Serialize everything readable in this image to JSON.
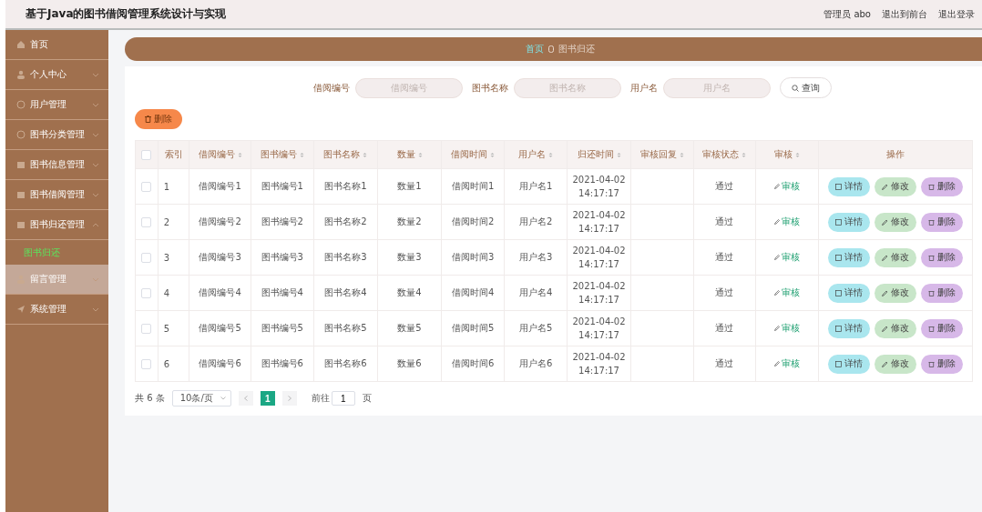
{
  "header": {
    "title": "基于Java的图书借阅管理系统设计与实现",
    "user": "管理员 abo",
    "links": [
      "退出到前台",
      "退出登录"
    ]
  },
  "sidebar": {
    "items": [
      {
        "label": "首页",
        "hovered": false
      },
      {
        "label": "个人中心",
        "expanded": false,
        "hovered": false
      },
      {
        "label": "用户管理",
        "expanded": false,
        "hovered": false
      },
      {
        "label": "图书分类管理",
        "expanded": false,
        "hovered": false
      },
      {
        "label": "图书信息管理",
        "expanded": false,
        "hovered": false
      },
      {
        "label": "图书借阅管理",
        "expanded": false,
        "hovered": false
      },
      {
        "label": "图书归还管理",
        "expanded": true,
        "hovered": false,
        "children": [
          {
            "label": "图书归还",
            "selected": true
          }
        ]
      },
      {
        "label": "留言管理",
        "expanded": false,
        "hovered": true
      },
      {
        "label": "系统管理",
        "expanded": false,
        "hovered": false
      }
    ]
  },
  "breadcrumb": [
    "首页",
    "图书归还"
  ],
  "search": {
    "fields": [
      {
        "label": "借阅编号",
        "placeholder": "借阅编号"
      },
      {
        "label": "图书名称",
        "placeholder": "图书名称"
      },
      {
        "label": "用户名",
        "placeholder": "用户名"
      }
    ],
    "button": "查询"
  },
  "delete_button": "删除",
  "table": {
    "header_checked": false,
    "columns": [
      {
        "label": "索引",
        "sortable": false
      },
      {
        "label": "借阅编号",
        "sortable": true
      },
      {
        "label": "图书编号",
        "sortable": true
      },
      {
        "label": "图书名称",
        "sortable": true
      },
      {
        "label": "数量",
        "sortable": true
      },
      {
        "label": "借阅时间",
        "sortable": true
      },
      {
        "label": "用户名",
        "sortable": true
      },
      {
        "label": "归还时间",
        "sortable": true
      },
      {
        "label": "审核回复",
        "sortable": true
      },
      {
        "label": "审核状态",
        "sortable": true
      },
      {
        "label": "审核",
        "sortable": true
      },
      {
        "label": "操作",
        "sortable": false
      }
    ],
    "rows": [
      {
        "checked": false,
        "cells": [
          "1",
          "借阅编号1",
          "图书编号1",
          "图书名称1",
          "数量1",
          "借阅时间1",
          "用户名1",
          "2021-04-02 14:17:17",
          "",
          "通过"
        ],
        "review": "审核",
        "actions": [
          {
            "label": "详情",
            "kind": "detail"
          },
          {
            "label": "修改",
            "kind": "edit"
          },
          {
            "label": "删除",
            "kind": "delete"
          }
        ]
      },
      {
        "checked": false,
        "cells": [
          "2",
          "借阅编号2",
          "图书编号2",
          "图书名称2",
          "数量2",
          "借阅时间2",
          "用户名2",
          "2021-04-02 14:17:17",
          "",
          "通过"
        ],
        "review": "审核",
        "actions": [
          {
            "label": "详情",
            "kind": "detail"
          },
          {
            "label": "修改",
            "kind": "edit"
          },
          {
            "label": "删除",
            "kind": "delete"
          }
        ]
      },
      {
        "checked": false,
        "cells": [
          "3",
          "借阅编号3",
          "图书编号3",
          "图书名称3",
          "数量3",
          "借阅时间3",
          "用户名3",
          "2021-04-02 14:17:17",
          "",
          "通过"
        ],
        "review": "审核",
        "actions": [
          {
            "label": "详情",
            "kind": "detail"
          },
          {
            "label": "修改",
            "kind": "edit"
          },
          {
            "label": "删除",
            "kind": "delete"
          }
        ]
      },
      {
        "checked": false,
        "cells": [
          "4",
          "借阅编号4",
          "图书编号4",
          "图书名称4",
          "数量4",
          "借阅时间4",
          "用户名4",
          "2021-04-02 14:17:17",
          "",
          "通过"
        ],
        "review": "审核",
        "actions": [
          {
            "label": "详情",
            "kind": "detail"
          },
          {
            "label": "修改",
            "kind": "edit"
          },
          {
            "label": "删除",
            "kind": "delete"
          }
        ]
      },
      {
        "checked": false,
        "cells": [
          "5",
          "借阅编号5",
          "图书编号5",
          "图书名称5",
          "数量5",
          "借阅时间5",
          "用户名5",
          "2021-04-02 14:17:17",
          "",
          "通过"
        ],
        "review": "审核",
        "actions": [
          {
            "label": "详情",
            "kind": "detail"
          },
          {
            "label": "修改",
            "kind": "edit"
          },
          {
            "label": "删除",
            "kind": "delete"
          }
        ]
      },
      {
        "checked": false,
        "cells": [
          "6",
          "借阅编号6",
          "图书编号6",
          "图书名称6",
          "数量6",
          "借阅时间6",
          "用户名6",
          "2021-04-02 14:17:17",
          "",
          "通过"
        ],
        "review": "审核",
        "actions": [
          {
            "label": "详情",
            "kind": "detail"
          },
          {
            "label": "修改",
            "kind": "edit"
          },
          {
            "label": "删除",
            "kind": "delete"
          }
        ]
      }
    ]
  },
  "pagination": {
    "total": "共 6 条",
    "page_size": "10条/页",
    "pages": [
      {
        "label": "1",
        "selected": true
      }
    ],
    "goto_label": "前往",
    "goto_value": "1",
    "goto_suffix": "页"
  }
}
